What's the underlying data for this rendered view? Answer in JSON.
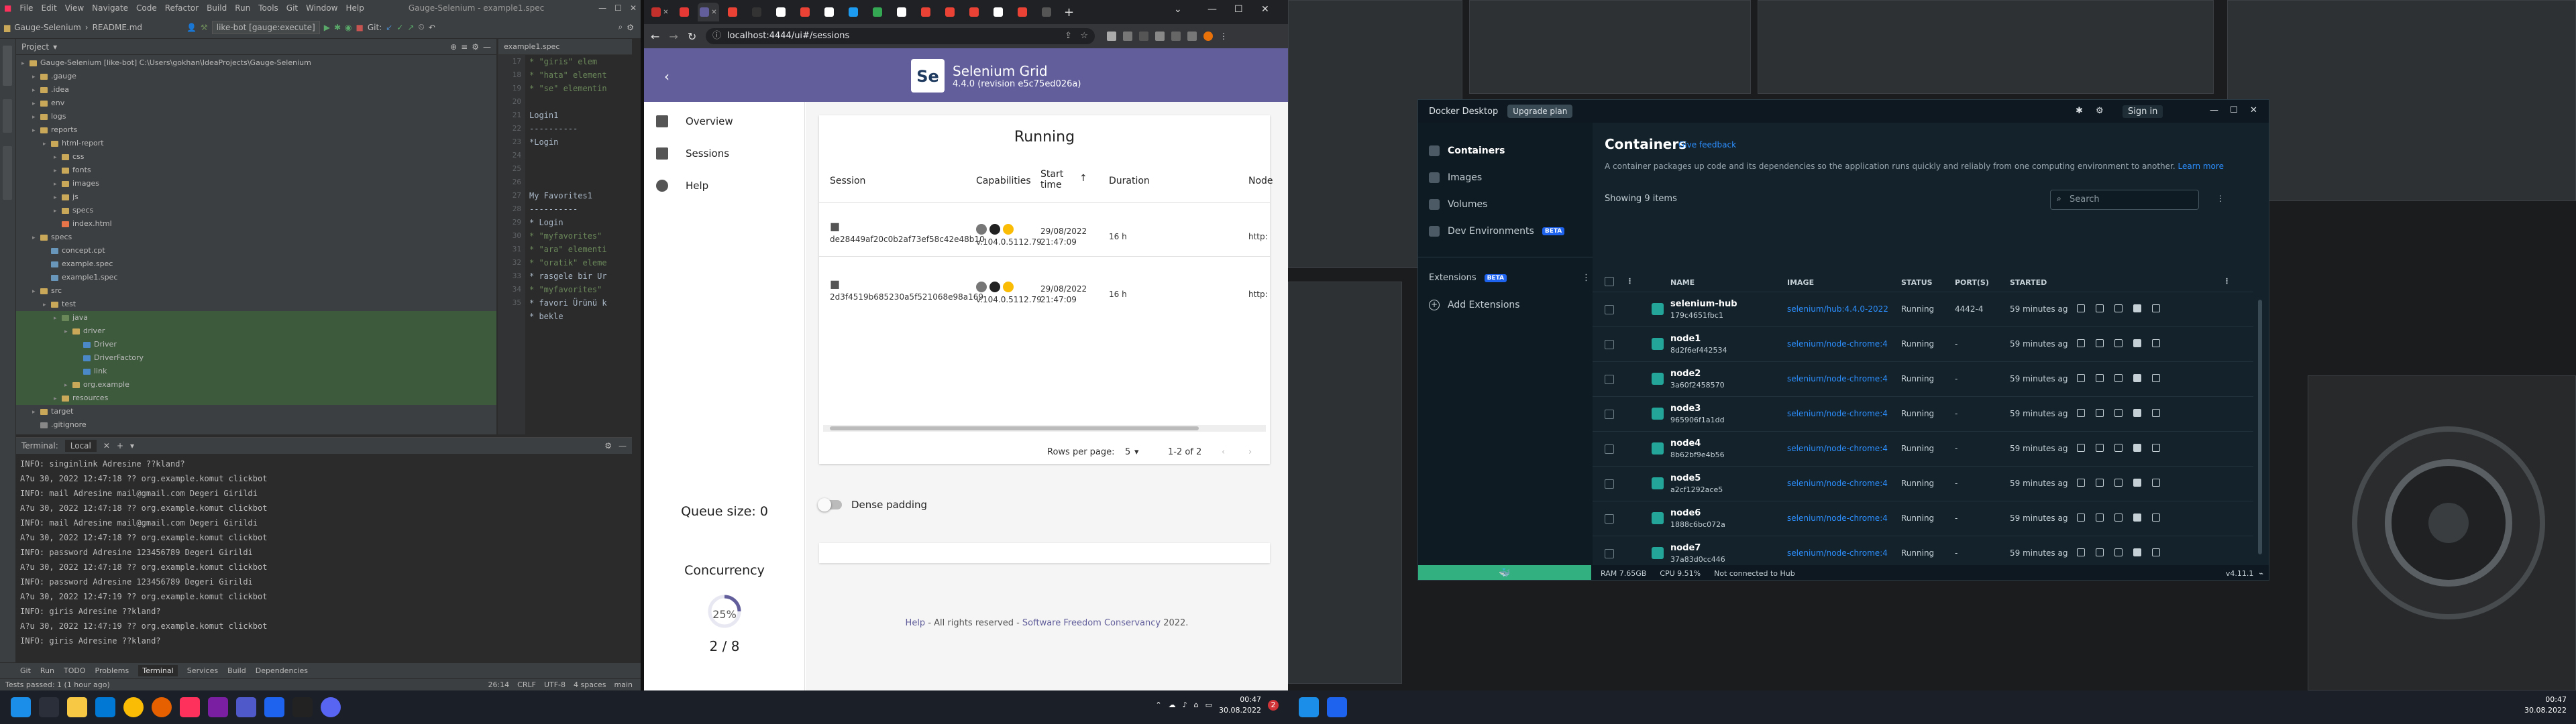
{
  "ide": {
    "title": "Gauge-Selenium - example1.spec",
    "menu": [
      "File",
      "Edit",
      "View",
      "Navigate",
      "Code",
      "Refactor",
      "Build",
      "Run",
      "Tools",
      "Git",
      "Window",
      "Help"
    ],
    "breadcrumb_project": "Gauge-Selenium",
    "breadcrumb_file": "README.md",
    "run_config": "like-bot [gauge:execute]",
    "project_label": "Project",
    "tree": [
      {
        "label": "Gauge-Selenium [like-bot]  C:\\Users\\gokhan\\IdeaProjects\\Gauge-Selenium",
        "indent": 0,
        "color": "#c9a959"
      },
      {
        "label": ".gauge",
        "indent": 1,
        "color": "#c9a959"
      },
      {
        "label": ".idea",
        "indent": 1,
        "color": "#c9a959"
      },
      {
        "label": "env",
        "indent": 1,
        "color": "#c9a959"
      },
      {
        "label": "logs",
        "indent": 1,
        "color": "#c9a959"
      },
      {
        "label": "reports",
        "indent": 1,
        "color": "#c9a959"
      },
      {
        "label": "html-report",
        "indent": 2,
        "color": "#c9a959"
      },
      {
        "label": "css",
        "indent": 3,
        "color": "#c9a959"
      },
      {
        "label": "fonts",
        "indent": 3,
        "color": "#c9a959"
      },
      {
        "label": "images",
        "indent": 3,
        "color": "#c9a959"
      },
      {
        "label": "js",
        "indent": 3,
        "color": "#c9a959"
      },
      {
        "label": "specs",
        "indent": 3,
        "color": "#c9a959"
      },
      {
        "label": "index.html",
        "indent": 3,
        "color": "#e8754a"
      },
      {
        "label": "specs",
        "indent": 1,
        "color": "#c9a959"
      },
      {
        "label": "concept.cpt",
        "indent": 2,
        "color": "#6897bb"
      },
      {
        "label": "example.spec",
        "indent": 2,
        "color": "#6897bb"
      },
      {
        "label": "example1.spec",
        "indent": 2,
        "color": "#6897bb"
      },
      {
        "label": "src",
        "indent": 1,
        "color": "#c9a959"
      },
      {
        "label": "test",
        "indent": 2,
        "color": "#c9a959"
      },
      {
        "label": "java",
        "indent": 3,
        "color": "#6a8759"
      },
      {
        "label": "driver",
        "indent": 4,
        "color": "#c9a959"
      },
      {
        "label": "Driver",
        "indent": 5,
        "color": "#4a88c7"
      },
      {
        "label": "DriverFactory",
        "indent": 5,
        "color": "#4a88c7"
      },
      {
        "label": "link",
        "indent": 5,
        "color": "#4a88c7"
      },
      {
        "label": "org.example",
        "indent": 4,
        "color": "#c9a959"
      },
      {
        "label": "resources",
        "indent": 3,
        "color": "#c9a959"
      },
      {
        "label": "target",
        "indent": 1,
        "color": "#c9a959"
      },
      {
        "label": ".gitignore",
        "indent": 1,
        "color": "#888888"
      }
    ],
    "editor_tab": "example1.spec",
    "line_numbers": [
      "17",
      "18",
      "19",
      "20",
      "21",
      "22",
      "23",
      "24",
      "25",
      "26",
      "27",
      "28",
      "29",
      "30",
      "31",
      "32",
      "33",
      "34",
      "35"
    ],
    "code": [
      "* \"giris\" elem",
      "* \"hata\" element",
      "* \"se\" elementin",
      "",
      "Login1",
      "----------",
      "*Login",
      "",
      "",
      "",
      "My Favorites1",
      "----------",
      "* Login",
      "* \"myfavorites\"",
      "* \"ara\" elementi",
      "* \"oratik\" eleme",
      "* rasgele bir Ur",
      "* \"myfavorites\"",
      "* favori Ürünü k",
      "* bekle"
    ],
    "terminal": {
      "label": "Terminal:",
      "session": "Local",
      "lines": [
        "INFO: singinlink Adresine ??kland?",
        "A?u 30, 2022 12:47:18 ?? org.example.komut clickbot",
        "INFO: mail Adresine mail@gmail.com Degeri Girildi",
        "A?u 30, 2022 12:47:18 ?? org.example.komut clickbot",
        "INFO: mail Adresine mail@gmail.com Degeri Girildi",
        "A?u 30, 2022 12:47:18 ?? org.example.komut clickbot",
        "INFO: password Adresine 123456789 Degeri Girildi",
        "A?u 30, 2022 12:47:18 ?? org.example.komut clickbot",
        "INFO: password Adresine 123456789 Degeri Girildi",
        "A?u 30, 2022 12:47:19 ?? org.example.komut clickbot",
        "INFO: giris Adresine ??kland?",
        "A?u 30, 2022 12:47:19 ?? org.example.komut clickbot",
        "INFO: giris Adresine ??kland?"
      ]
    },
    "bottom_tabs": [
      "Git",
      "Run",
      "TODO",
      "Problems",
      "Terminal",
      "Services",
      "Build",
      "Dependencies"
    ],
    "status_left": "Tests passed: 1 (1 hour ago)",
    "status_right": [
      "26:14",
      "CRLF",
      "UTF-8",
      "4 spaces",
      "main"
    ]
  },
  "chrome": {
    "url": "localhost:4444/ui#/sessions",
    "brand": "Selenium Grid",
    "version": "4.4.0 (revision e5c75ed026a)",
    "logo_text": "Se",
    "nav": [
      "Overview",
      "Sessions",
      "Help"
    ],
    "queue": "Queue size: 0",
    "concurrency_label": "Concurrency",
    "concurrency_pct": "25%",
    "concurrency_ratio": "2 / 8",
    "concurrency_fraction": 0.25,
    "card_title": "Running",
    "columns": [
      "Session",
      "Capabilities",
      "Start time",
      "Duration",
      "Node"
    ],
    "sessions": [
      {
        "id": "de28449af20c0b2af73ef58c42e48b10",
        "version": "v.104.0.5112.79",
        "start_date": "29/08/2022",
        "start_time": "21:47:09",
        "duration": "16 h",
        "node": "http:"
      },
      {
        "id": "2d3f4519b685230a5f521068e98a169",
        "version": "v.104.0.5112.79",
        "start_date": "29/08/2022",
        "start_time": "21:47:09",
        "duration": "16 h",
        "node": "http:"
      }
    ],
    "rows_per_page_label": "Rows per page:",
    "rows_per_page": "5",
    "range": "1-2 of 2",
    "dense_label": "Dense padding",
    "footer_help": "Help",
    "footer_text": " - All rights reserved - ",
    "footer_sfc": "Software Freedom Conservancy",
    "footer_year": " 2022."
  },
  "docker": {
    "app": "Docker Desktop",
    "upgrade": "Upgrade plan",
    "sign_in": "Sign in",
    "nav": [
      "Containers",
      "Images",
      "Volumes",
      "Dev Environments"
    ],
    "beta": "BETA",
    "extensions": "Extensions",
    "add_extensions": "Add Extensions",
    "title": "Containers",
    "feedback": "Give feedback",
    "desc": "A container packages up code and its dependencies so the application runs quickly and reliably from one computing environment to another.",
    "learn_more": "Learn more",
    "count": "Showing 9 items",
    "search_placeholder": "Search",
    "columns": [
      "NAME",
      "IMAGE",
      "STATUS",
      "PORT(S)",
      "STARTED"
    ],
    "containers": [
      {
        "name": "selenium-hub",
        "id": "179c4651fbc1",
        "image": "selenium/hub:4.4.0-2022",
        "status": "Running",
        "port": "4442-4",
        "started": "59 minutes ag"
      },
      {
        "name": "node1",
        "id": "8d2f6ef442534",
        "image": "selenium/node-chrome:4",
        "status": "Running",
        "port": "-",
        "started": "59 minutes ag"
      },
      {
        "name": "node2",
        "id": "3a60f2458570",
        "image": "selenium/node-chrome:4",
        "status": "Running",
        "port": "-",
        "started": "59 minutes ag"
      },
      {
        "name": "node3",
        "id": "965906f1a1dd",
        "image": "selenium/node-chrome:4",
        "status": "Running",
        "port": "-",
        "started": "59 minutes ag"
      },
      {
        "name": "node4",
        "id": "8b62bf9e4b56",
        "image": "selenium/node-chrome:4",
        "status": "Running",
        "port": "-",
        "started": "59 minutes ag"
      },
      {
        "name": "node5",
        "id": "a2cf1292ace5",
        "image": "selenium/node-chrome:4",
        "status": "Running",
        "port": "-",
        "started": "59 minutes ag"
      },
      {
        "name": "node6",
        "id": "1888c6bc072a",
        "image": "selenium/node-chrome:4",
        "status": "Running",
        "port": "-",
        "started": "59 minutes ag"
      },
      {
        "name": "node7",
        "id": "37a83d0cc446",
        "image": "selenium/node-chrome:4",
        "status": "Running",
        "port": "-",
        "started": "59 minutes ag"
      }
    ],
    "ram": "RAM 7.65GB",
    "cpu": "CPU 9.51%",
    "hub": "Not connected to Hub",
    "version": "v4.11.1"
  },
  "taskbar_left": {
    "time": "00:47",
    "date": "30.08.2022",
    "badge": "2"
  },
  "taskbar_right": {
    "time": "00:47",
    "date": "30.08.2022"
  }
}
